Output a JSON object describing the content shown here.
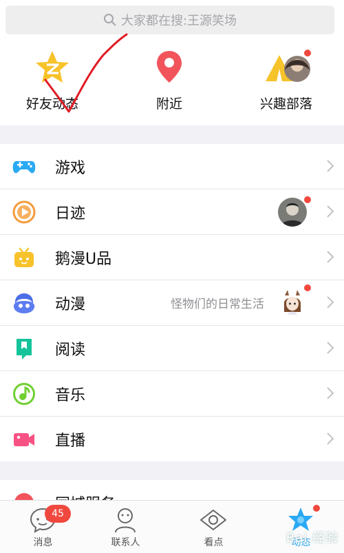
{
  "search": {
    "text": "大家都在搜:王源笑场"
  },
  "shortcuts": [
    {
      "label": "好友动态",
      "icon": "qzone-star-icon",
      "color": "#f8c22a"
    },
    {
      "label": "附近",
      "icon": "location-pin-icon",
      "color": "#f2545b"
    },
    {
      "label": "兴趣部落",
      "icon": "tent-icon",
      "color": "#f7c32b"
    }
  ],
  "menu": [
    {
      "label": "游戏",
      "icon": "gamepad-icon",
      "color": "#2aa9f4"
    },
    {
      "label": "日迹",
      "icon": "play-circle-icon",
      "color": "#f59a3b"
    },
    {
      "label": "鹅漫U品",
      "icon": "tv-box-icon",
      "color": "#f7c22a"
    },
    {
      "label": "动漫",
      "icon": "cartoon-face-icon",
      "color": "#4d6ee8",
      "subtitle": "怪物们的日常生活"
    },
    {
      "label": "阅读",
      "icon": "bookmark-book-icon",
      "color": "#15c39a"
    },
    {
      "label": "音乐",
      "icon": "music-note-icon",
      "color": "#6fcf2f"
    },
    {
      "label": "直播",
      "icon": "video-camera-icon",
      "color": "#f75283"
    }
  ],
  "menu2": [
    {
      "label": "同城服务",
      "icon": "city-service-icon",
      "color": "#f2545b"
    }
  ],
  "tabs": [
    {
      "label": "消息",
      "badge": "45",
      "icon": "chat-bubble-icon"
    },
    {
      "label": "联系人",
      "icon": "contact-person-icon"
    },
    {
      "label": "看点",
      "icon": "eye-icon"
    },
    {
      "label": "动态",
      "icon": "star-active-icon",
      "active": true
    }
  ],
  "watermark": "Bai 经验",
  "colors": {
    "accent": "#2aa9f4",
    "badge": "#f0483e",
    "annotation": "#e01b24"
  }
}
